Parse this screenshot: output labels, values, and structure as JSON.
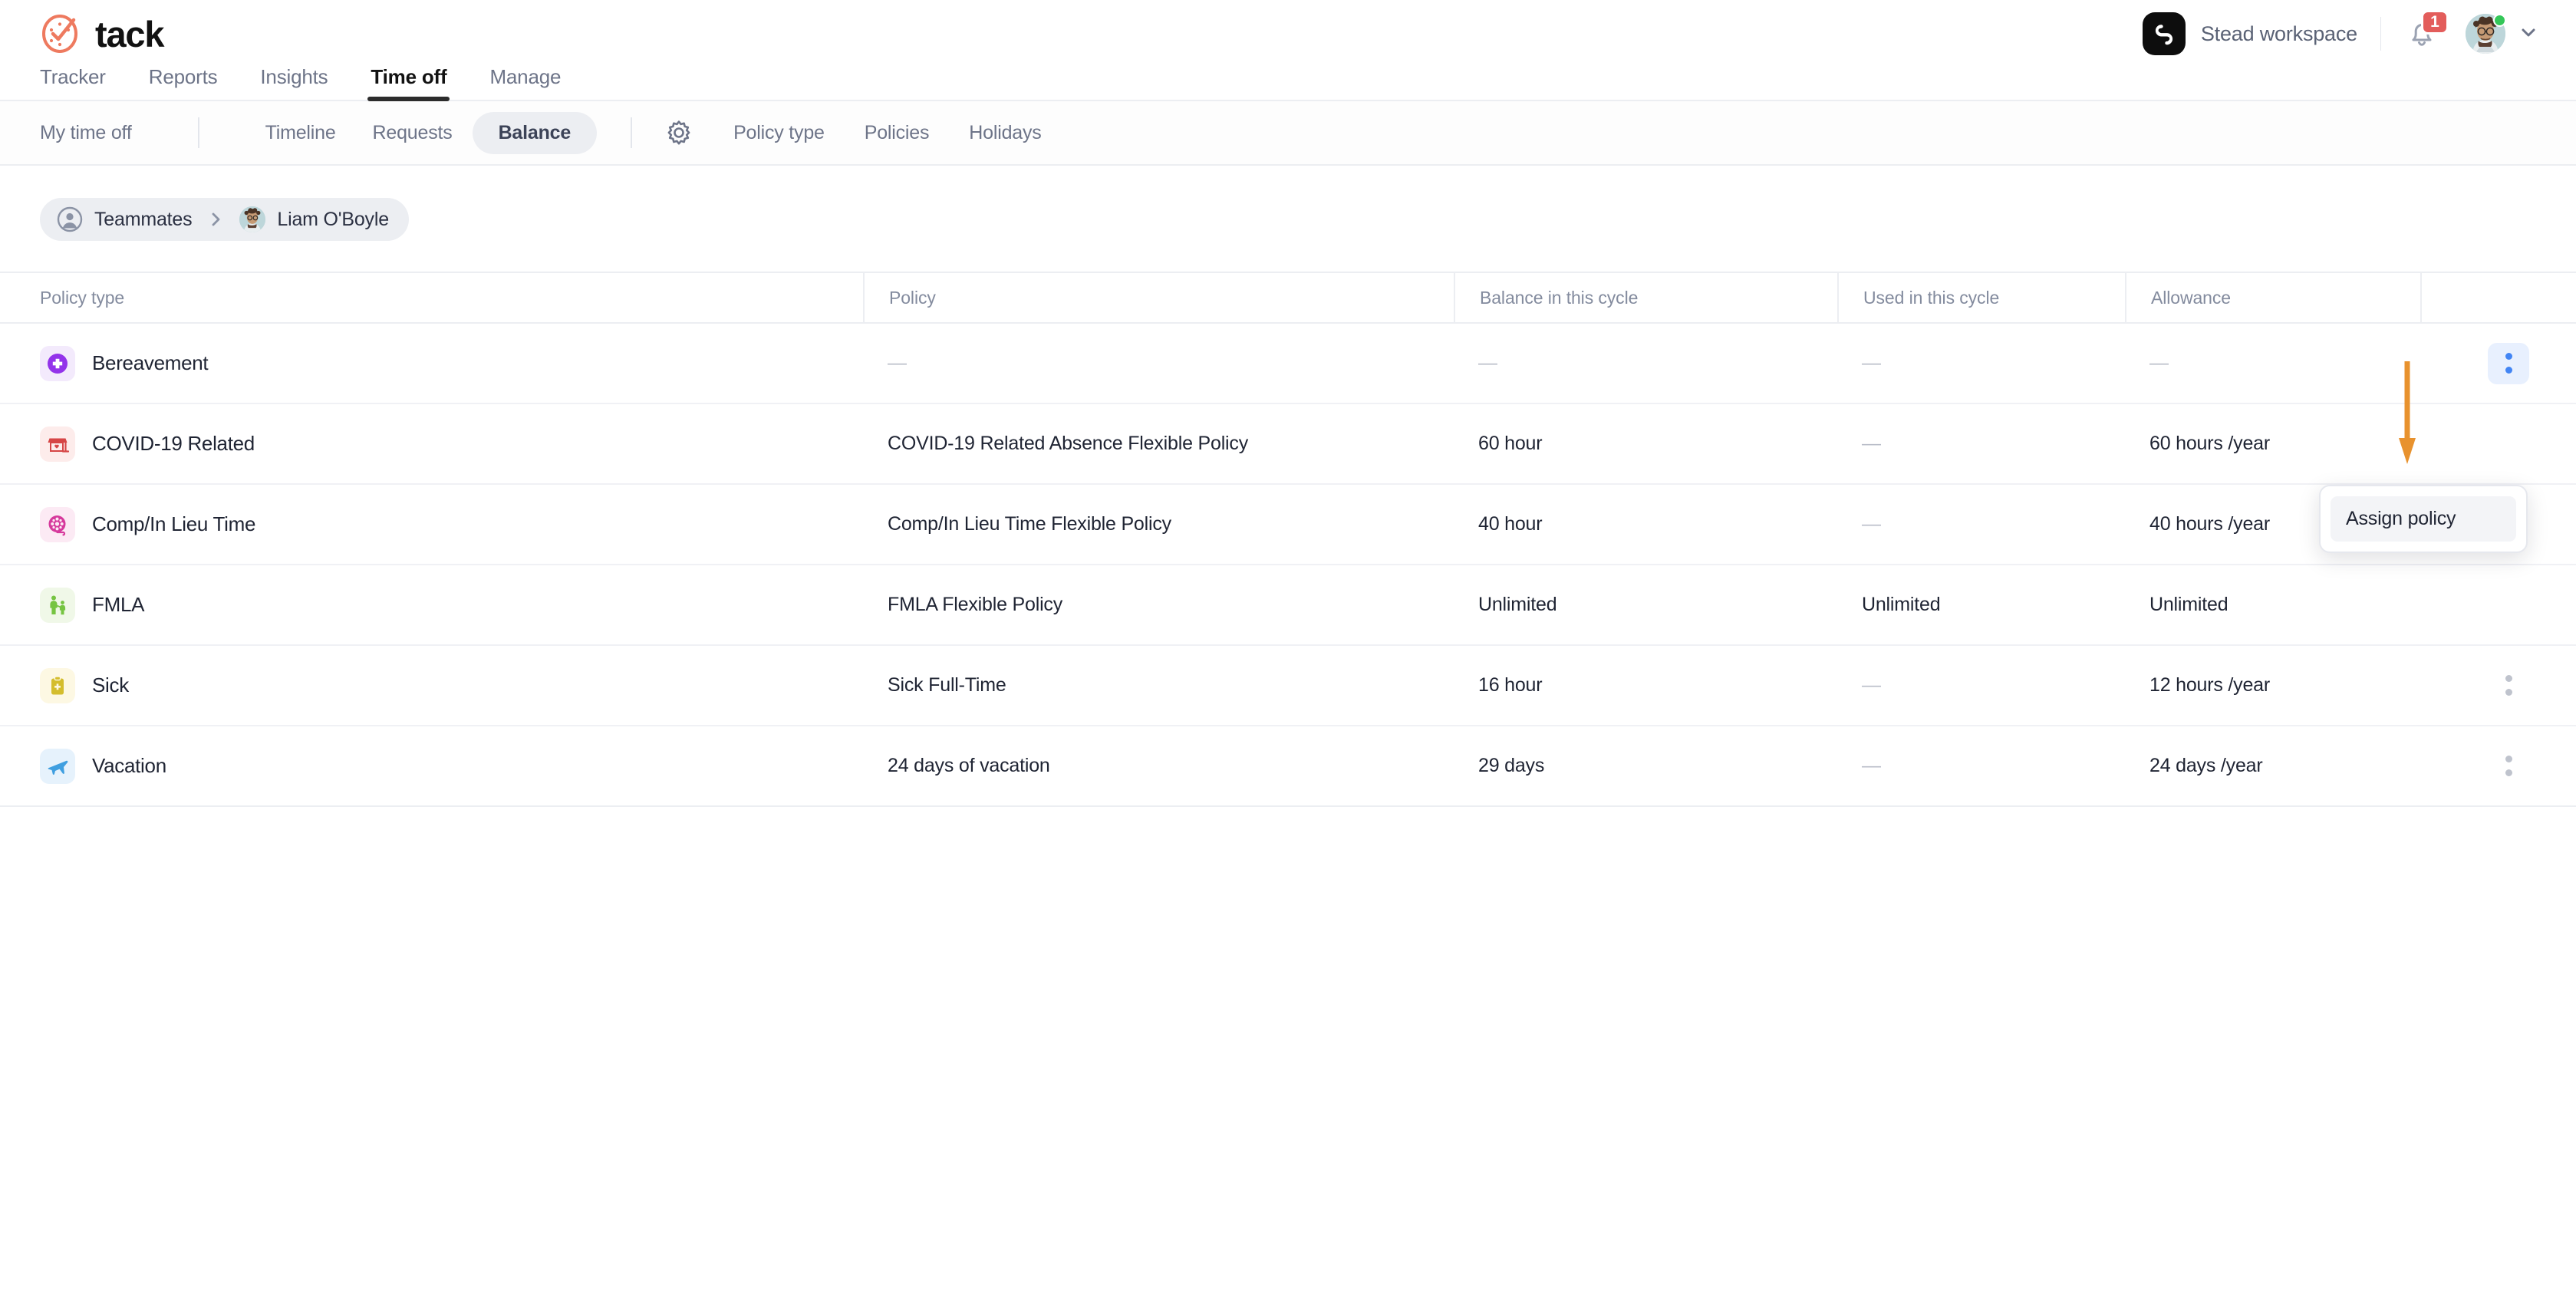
{
  "brand": {
    "name": "tack",
    "logo_icon": "clock-check-icon",
    "color": "#ee7a5f"
  },
  "topbar": {
    "workspace_name": "Stead workspace",
    "workspace_logo_icon": "workspace-logo-icon",
    "notifications_icon": "bell-icon",
    "notification_count": "1",
    "badge_color": "#e35d5b",
    "avatar_icon": "user-avatar",
    "status_dot_color": "#34c759",
    "account_chevron_icon": "chevron-down-icon"
  },
  "mainnav": {
    "items": [
      {
        "label": "Tracker",
        "active": false
      },
      {
        "label": "Reports",
        "active": false
      },
      {
        "label": "Insights",
        "active": false
      },
      {
        "label": "Time off",
        "active": true
      },
      {
        "label": "Manage",
        "active": false
      }
    ]
  },
  "subnav": {
    "my_time_off": "My time off",
    "items": [
      {
        "label": "Timeline",
        "active": false
      },
      {
        "label": "Requests",
        "active": false
      },
      {
        "label": "Balance",
        "active": true
      }
    ],
    "settings_icon": "gear-icon",
    "admin_items": [
      {
        "label": "Policy type"
      },
      {
        "label": "Policies"
      },
      {
        "label": "Holidays"
      }
    ]
  },
  "breadcrumb": {
    "root_icon": "person-circle-icon",
    "root_label": "Teammates",
    "separator_icon": "chevron-right-icon",
    "person_avatar_icon": "user-avatar",
    "person_label": "Liam O'Boyle"
  },
  "table": {
    "columns": [
      "Policy type",
      "Policy",
      "Balance in this cycle",
      "Used in this cycle",
      "Allowance"
    ],
    "rows": [
      {
        "policy_type": "Bereavement",
        "icon": "medical-cross-circle-icon",
        "icon_bg": "#f3eafc",
        "icon_color": "#9333ea",
        "policy": "—",
        "balance": "—",
        "used": "—",
        "allowance": "—",
        "has_menu": true,
        "menu_active": true
      },
      {
        "policy_type": "COVID-19 Related",
        "icon": "storefront-icon",
        "icon_bg": "#fdeceb",
        "icon_color": "#d64545",
        "policy": "COVID-19 Related Absence Flexible Policy",
        "balance": "60 hour",
        "used": "—",
        "allowance": "60 hours /year",
        "has_menu": false,
        "menu_active": false
      },
      {
        "policy_type": "Comp/In Lieu Time",
        "icon": "film-reel-icon",
        "icon_bg": "#fceaf4",
        "icon_color": "#d6399c",
        "policy": "Comp/In Lieu Time Flexible Policy",
        "balance": "40 hour",
        "used": "—",
        "allowance": "40 hours /year",
        "has_menu": true,
        "menu_active": false
      },
      {
        "policy_type": "FMLA",
        "icon": "parent-child-icon",
        "icon_bg": "#f0f8e8",
        "icon_color": "#76c442",
        "policy": "FMLA Flexible Policy",
        "balance": "Unlimited",
        "used": "Unlimited",
        "allowance": "Unlimited",
        "has_menu": false,
        "menu_active": false
      },
      {
        "policy_type": "Sick",
        "icon": "clipboard-medical-icon",
        "icon_bg": "#fdf8e3",
        "icon_color": "#d4bd2d",
        "policy": "Sick Full-Time",
        "balance": "16 hour",
        "used": "—",
        "allowance": "12 hours /year",
        "has_menu": true,
        "menu_active": false
      },
      {
        "policy_type": "Vacation",
        "icon": "airplane-icon",
        "icon_bg": "#e6f2fc",
        "icon_color": "#3f9fe0",
        "policy": "24 days of vacation",
        "balance": "29 days",
        "used": "—",
        "allowance": "24 days /year",
        "has_menu": true,
        "menu_active": false
      }
    ]
  },
  "dropdown": {
    "items": [
      {
        "label": "Assign policy"
      }
    ]
  },
  "annotation": {
    "arrow_color": "#e8922e",
    "arrow_direction": "down"
  }
}
